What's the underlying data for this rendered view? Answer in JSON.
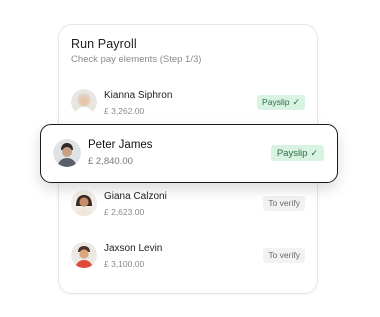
{
  "card": {
    "title": "Run Payroll",
    "subtitle": "Check pay elements (Step 1/3)"
  },
  "employees": [
    {
      "name": "Kianna Siphron",
      "amount": "£ 3,262.00",
      "status": "Payslip",
      "status_icon": "check-icon"
    },
    {
      "name": "Peter James",
      "amount": "£ 2,840.00",
      "status": "Payslip",
      "status_icon": "check-icon"
    },
    {
      "name": "Giana Calzoni",
      "amount": "£ 2,623.00",
      "status": "To verify"
    },
    {
      "name": "Jaxson Levin",
      "amount": "£ 3,100.00",
      "status": "To verify"
    }
  ],
  "colors": {
    "payslip_bg": "#d8f3e2",
    "payslip_text": "#2d6b47",
    "verify_bg": "#f2f2f2",
    "focus_border": "#1a1a1a"
  }
}
